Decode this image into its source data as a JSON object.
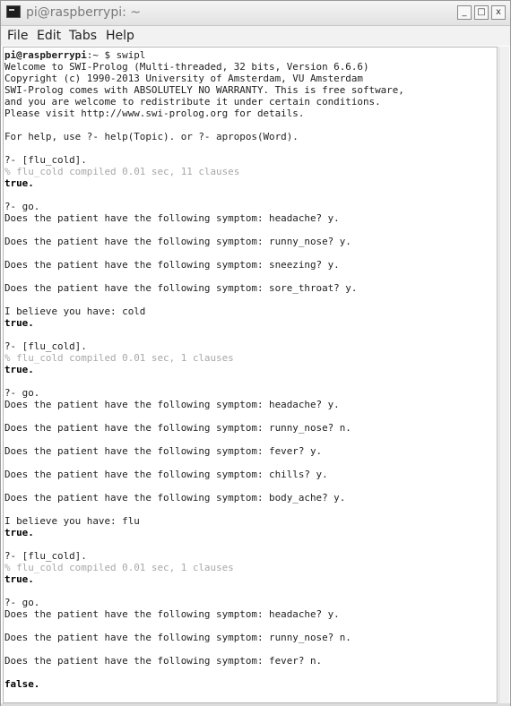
{
  "window": {
    "title": "pi@raspberrypi: ~",
    "minimize_label": "_",
    "maximize_label": "□",
    "close_label": "x"
  },
  "menu": {
    "items": [
      "File",
      "Edit",
      "Tabs",
      "Help"
    ]
  },
  "terminal": {
    "prompt_user": "pi@raspberrypi",
    "prompt_rest": ":~ $ swipl",
    "lines": [
      {
        "text": "Welcome to SWI-Prolog (Multi-threaded, 32 bits, Version 6.6.6)",
        "style": "normal"
      },
      {
        "text": "Copyright (c) 1990-2013 University of Amsterdam, VU Amsterdam",
        "style": "normal"
      },
      {
        "text": "SWI-Prolog comes with ABSOLUTELY NO WARRANTY. This is free software,",
        "style": "normal"
      },
      {
        "text": "and you are welcome to redistribute it under certain conditions.",
        "style": "normal"
      },
      {
        "text": "Please visit http://www.swi-prolog.org for details.",
        "style": "normal"
      },
      {
        "text": "",
        "style": "normal"
      },
      {
        "text": "For help, use ?- help(Topic). or ?- apropos(Word).",
        "style": "normal"
      },
      {
        "text": "",
        "style": "normal"
      },
      {
        "text": "?- [flu_cold].",
        "style": "normal"
      },
      {
        "text": "% flu_cold compiled 0.01 sec, 11 clauses",
        "style": "gray"
      },
      {
        "text": "true.",
        "style": "bold"
      },
      {
        "text": "",
        "style": "normal"
      },
      {
        "text": "?- go.",
        "style": "normal"
      },
      {
        "text": "Does the patient have the following symptom: headache? y.",
        "style": "normal"
      },
      {
        "text": "",
        "style": "normal"
      },
      {
        "text": "Does the patient have the following symptom: runny_nose? y.",
        "style": "normal"
      },
      {
        "text": "",
        "style": "normal"
      },
      {
        "text": "Does the patient have the following symptom: sneezing? y.",
        "style": "normal"
      },
      {
        "text": "",
        "style": "normal"
      },
      {
        "text": "Does the patient have the following symptom: sore_throat? y.",
        "style": "normal"
      },
      {
        "text": "",
        "style": "normal"
      },
      {
        "text": "I believe you have: cold",
        "style": "normal"
      },
      {
        "text": "true.",
        "style": "bold"
      },
      {
        "text": "",
        "style": "normal"
      },
      {
        "text": "?- [flu_cold].",
        "style": "normal"
      },
      {
        "text": "% flu_cold compiled 0.01 sec, 1 clauses",
        "style": "gray"
      },
      {
        "text": "true.",
        "style": "bold"
      },
      {
        "text": "",
        "style": "normal"
      },
      {
        "text": "?- go.",
        "style": "normal"
      },
      {
        "text": "Does the patient have the following symptom: headache? y.",
        "style": "normal"
      },
      {
        "text": "",
        "style": "normal"
      },
      {
        "text": "Does the patient have the following symptom: runny_nose? n.",
        "style": "normal"
      },
      {
        "text": "",
        "style": "normal"
      },
      {
        "text": "Does the patient have the following symptom: fever? y.",
        "style": "normal"
      },
      {
        "text": "",
        "style": "normal"
      },
      {
        "text": "Does the patient have the following symptom: chills? y.",
        "style": "normal"
      },
      {
        "text": "",
        "style": "normal"
      },
      {
        "text": "Does the patient have the following symptom: body_ache? y.",
        "style": "normal"
      },
      {
        "text": "",
        "style": "normal"
      },
      {
        "text": "I believe you have: flu",
        "style": "normal"
      },
      {
        "text": "true.",
        "style": "bold"
      },
      {
        "text": "",
        "style": "normal"
      },
      {
        "text": "?- [flu_cold].",
        "style": "normal"
      },
      {
        "text": "% flu_cold compiled 0.01 sec, 1 clauses",
        "style": "gray"
      },
      {
        "text": "true.",
        "style": "bold"
      },
      {
        "text": "",
        "style": "normal"
      },
      {
        "text": "?- go.",
        "style": "normal"
      },
      {
        "text": "Does the patient have the following symptom: headache? y.",
        "style": "normal"
      },
      {
        "text": "",
        "style": "normal"
      },
      {
        "text": "Does the patient have the following symptom: runny_nose? n.",
        "style": "normal"
      },
      {
        "text": "",
        "style": "normal"
      },
      {
        "text": "Does the patient have the following symptom: fever? n.",
        "style": "normal"
      },
      {
        "text": "",
        "style": "normal"
      },
      {
        "text": "false.",
        "style": "bold"
      }
    ]
  },
  "colors": {
    "text": "#1e1e1e",
    "comment": "#a8a8a8",
    "background": "#ffffff"
  }
}
